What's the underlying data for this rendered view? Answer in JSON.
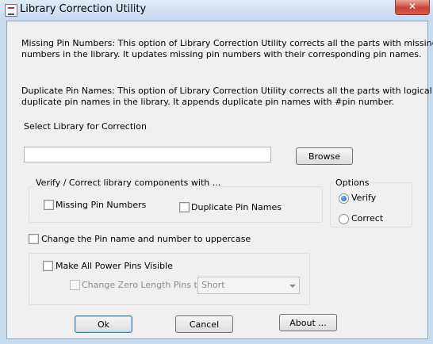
{
  "window": {
    "title": "Library Correction Utility",
    "close_label": "✕"
  },
  "description": {
    "missing_pin_line1": "Missing Pin Numbers: This option of Library Correction Utility corrects all the parts with missing pin",
    "missing_pin_line2": "numbers in the library. It updates missing pin numbers with their corresponding pin names.",
    "duplicate_pin_line1": "Duplicate Pin Names: This option of Library Correction Utility corrects all the parts with logical",
    "duplicate_pin_line2": "duplicate pin names in the library. It appends duplicate pin names with #pin number."
  },
  "library": {
    "label": "Select Library for Correction",
    "path_value": "",
    "browse_label": "Browse"
  },
  "verify_group": {
    "legend": "Verify / Correct library components with ...",
    "missing_pin_numbers": {
      "label": "Missing Pin Numbers",
      "checked": false
    },
    "duplicate_pin_names": {
      "label": "Duplicate Pin Names",
      "checked": false
    }
  },
  "options_group": {
    "legend": "Options",
    "verify_label": "Verify",
    "correct_label": "Correct",
    "selected": "Verify"
  },
  "uppercase": {
    "label": "Change the Pin name and number to uppercase",
    "checked": false
  },
  "power_pins": {
    "label": "Make All Power Pins Visible",
    "checked": false
  },
  "zero_length": {
    "label": "Change Zero Length Pins to :",
    "checked": false,
    "enabled": false,
    "selected_value": "Short"
  },
  "buttons": {
    "ok_label": "Ok",
    "cancel_label": "Cancel",
    "about_label": "About ..."
  }
}
